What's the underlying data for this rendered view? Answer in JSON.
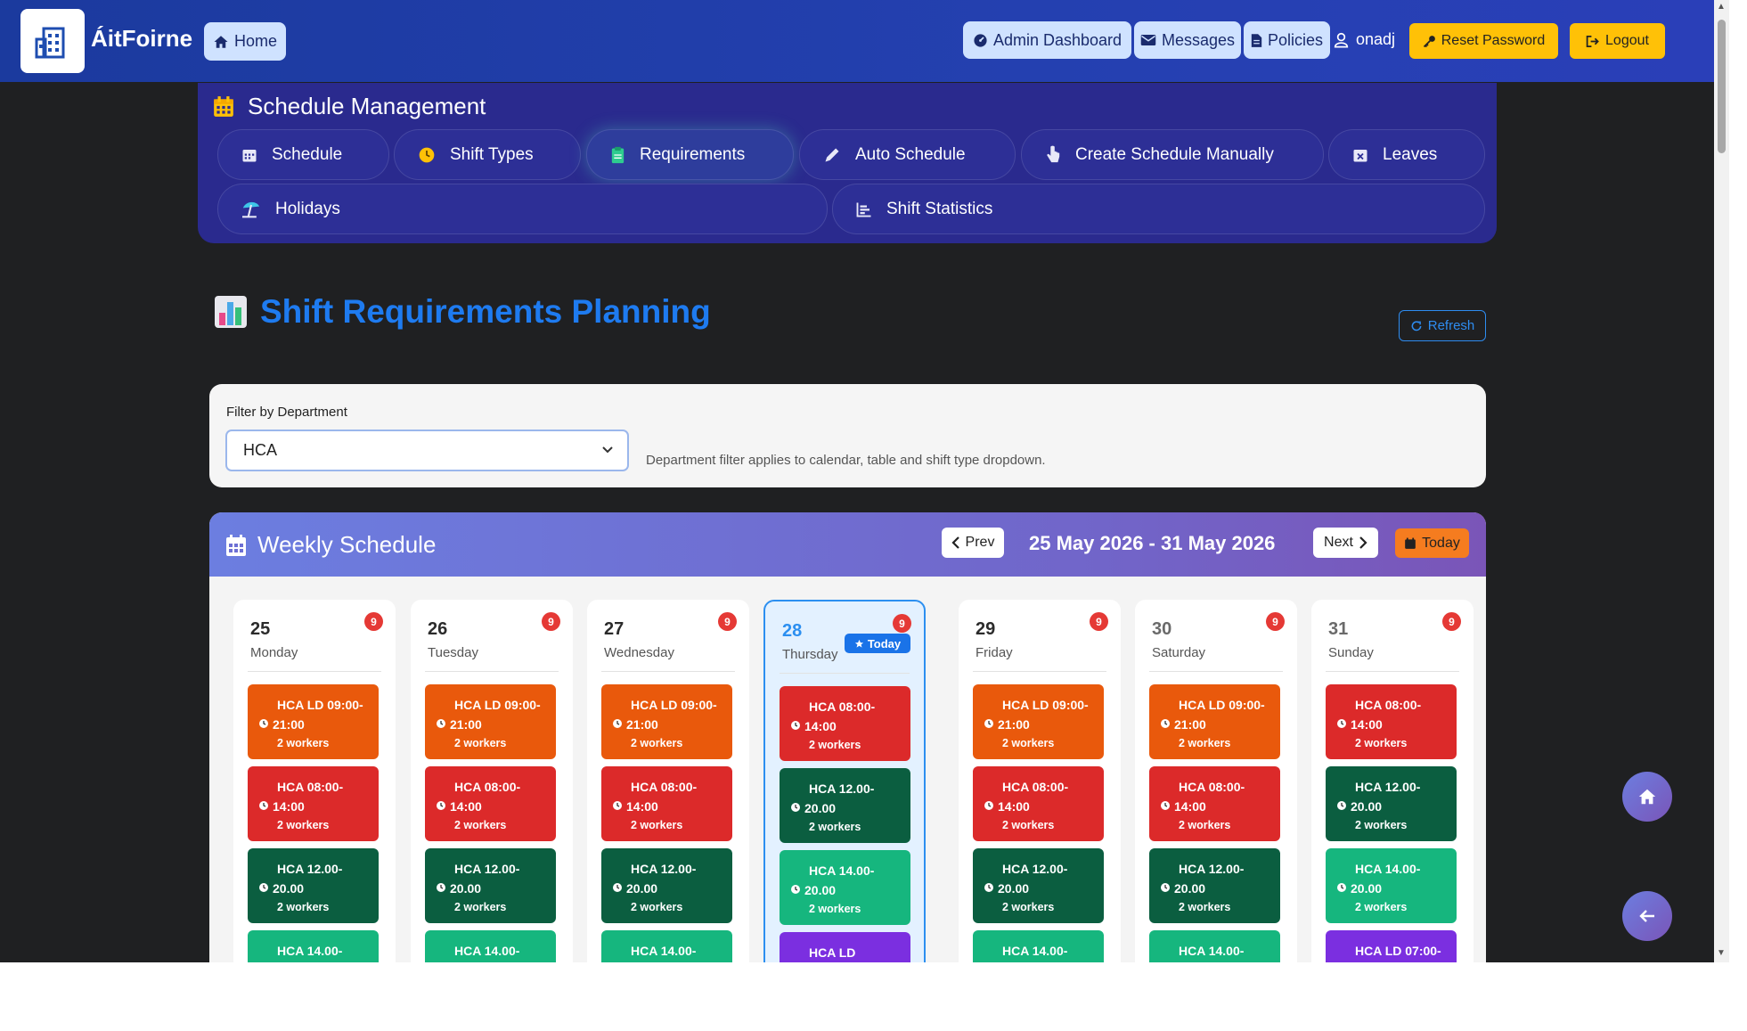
{
  "navbar": {
    "brand": "ÁitFoirne",
    "home_label": "Home",
    "admin_dashboard_label": "Admin Dashboard",
    "messages_label": "Messages",
    "policies_label": "Policies",
    "username": "onadj",
    "reset_password_label": "Reset Password",
    "logout_label": "Logout"
  },
  "schedule_management": {
    "title": "Schedule Management",
    "tabs": [
      {
        "label": "Schedule",
        "icon": "calendar-icon"
      },
      {
        "label": "Shift Types",
        "icon": "clock-icon"
      },
      {
        "label": "Requirements",
        "icon": "clipboard-icon",
        "active": true
      },
      {
        "label": "Auto Schedule",
        "icon": "pencil-icon"
      },
      {
        "label": "Create Schedule Manually",
        "icon": "hand-pointer-icon"
      },
      {
        "label": "Leaves",
        "icon": "calendar-x-icon"
      },
      {
        "label": "Holidays",
        "icon": "umbrella-beach-icon"
      },
      {
        "label": "Shift Statistics",
        "icon": "bar-chart-icon"
      }
    ]
  },
  "page": {
    "title": "Shift Requirements Planning",
    "refresh_label": "Refresh"
  },
  "filter": {
    "label": "Filter by Department",
    "selected": "HCA",
    "help": "Department filter applies to calendar, table and shift type dropdown."
  },
  "weekly": {
    "title": "Weekly Schedule",
    "prev_label": "Prev",
    "next_label": "Next",
    "today_label": "Today",
    "range": "25 May 2026 - 31 May 2026",
    "today_badge": "Today"
  },
  "days": [
    {
      "num": "25",
      "name": "Monday",
      "count": "9",
      "shifts": [
        {
          "l1": "HCA LD 09:00-",
          "l2": "21:00",
          "l3": "2 workers",
          "color": "#e9590c"
        },
        {
          "l1": "HCA 08:00-",
          "l2": "14:00",
          "l3": "2 workers",
          "color": "#dc2a2a"
        },
        {
          "l1": "HCA 12.00-",
          "l2": "20.00",
          "l3": "2 workers",
          "color": "#0b5e40"
        },
        {
          "l1": "HCA 14.00-",
          "l2": "",
          "l3": "",
          "color": "#16b67e"
        }
      ]
    },
    {
      "num": "26",
      "name": "Tuesday",
      "count": "9",
      "shifts": [
        {
          "l1": "HCA LD 09:00-",
          "l2": "21:00",
          "l3": "2 workers",
          "color": "#e9590c"
        },
        {
          "l1": "HCA 08:00-",
          "l2": "14:00",
          "l3": "2 workers",
          "color": "#dc2a2a"
        },
        {
          "l1": "HCA 12.00-",
          "l2": "20.00",
          "l3": "2 workers",
          "color": "#0b5e40"
        },
        {
          "l1": "HCA 14.00-",
          "l2": "",
          "l3": "",
          "color": "#16b67e"
        }
      ]
    },
    {
      "num": "27",
      "name": "Wednesday",
      "count": "9",
      "shifts": [
        {
          "l1": "HCA LD 09:00-",
          "l2": "21:00",
          "l3": "2 workers",
          "color": "#e9590c"
        },
        {
          "l1": "HCA 08:00-",
          "l2": "14:00",
          "l3": "2 workers",
          "color": "#dc2a2a"
        },
        {
          "l1": "HCA 12.00-",
          "l2": "20.00",
          "l3": "2 workers",
          "color": "#0b5e40"
        },
        {
          "l1": "HCA 14.00-",
          "l2": "",
          "l3": "",
          "color": "#16b67e"
        }
      ]
    },
    {
      "num": "28",
      "name": "Thursday",
      "count": "9",
      "today": true,
      "shifts": [
        {
          "l1": "HCA 08:00-",
          "l2": "14:00",
          "l3": "2 workers",
          "color": "#dc2a2a"
        },
        {
          "l1": "HCA 12.00-",
          "l2": "20.00",
          "l3": "2 workers",
          "color": "#0b5e40"
        },
        {
          "l1": "HCA 14.00-",
          "l2": "20.00",
          "l3": "2 workers",
          "color": "#16b67e"
        },
        {
          "l1": "HCA LD",
          "l2": "",
          "l3": "",
          "color": "#7b2fe0"
        }
      ]
    },
    {
      "num": "29",
      "name": "Friday",
      "count": "9",
      "shifts": [
        {
          "l1": "HCA LD 09:00-",
          "l2": "21:00",
          "l3": "2 workers",
          "color": "#e9590c"
        },
        {
          "l1": "HCA 08:00-",
          "l2": "14:00",
          "l3": "2 workers",
          "color": "#dc2a2a"
        },
        {
          "l1": "HCA 12.00-",
          "l2": "20.00",
          "l3": "2 workers",
          "color": "#0b5e40"
        },
        {
          "l1": "HCA 14.00-",
          "l2": "",
          "l3": "",
          "color": "#16b67e"
        }
      ]
    },
    {
      "num": "30",
      "name": "Saturday",
      "count": "9",
      "weekend": true,
      "shifts": [
        {
          "l1": "HCA LD 09:00-",
          "l2": "21:00",
          "l3": "2 workers",
          "color": "#e9590c"
        },
        {
          "l1": "HCA 08:00-",
          "l2": "14:00",
          "l3": "2 workers",
          "color": "#dc2a2a"
        },
        {
          "l1": "HCA 12.00-",
          "l2": "20.00",
          "l3": "2 workers",
          "color": "#0b5e40"
        },
        {
          "l1": "HCA 14.00-",
          "l2": "",
          "l3": "",
          "color": "#16b67e"
        }
      ]
    },
    {
      "num": "31",
      "name": "Sunday",
      "count": "9",
      "weekend": true,
      "shifts": [
        {
          "l1": "HCA 08:00-",
          "l2": "14:00",
          "l3": "2 workers",
          "color": "#dc2a2a"
        },
        {
          "l1": "HCA 12.00-",
          "l2": "20.00",
          "l3": "2 workers",
          "color": "#0b5e40"
        },
        {
          "l1": "HCA 14.00-",
          "l2": "20.00",
          "l3": "2 workers",
          "color": "#16b67e"
        },
        {
          "l1": "HCA LD 07:00-",
          "l2": "",
          "l3": "",
          "color": "#7b2fe0"
        }
      ]
    }
  ]
}
